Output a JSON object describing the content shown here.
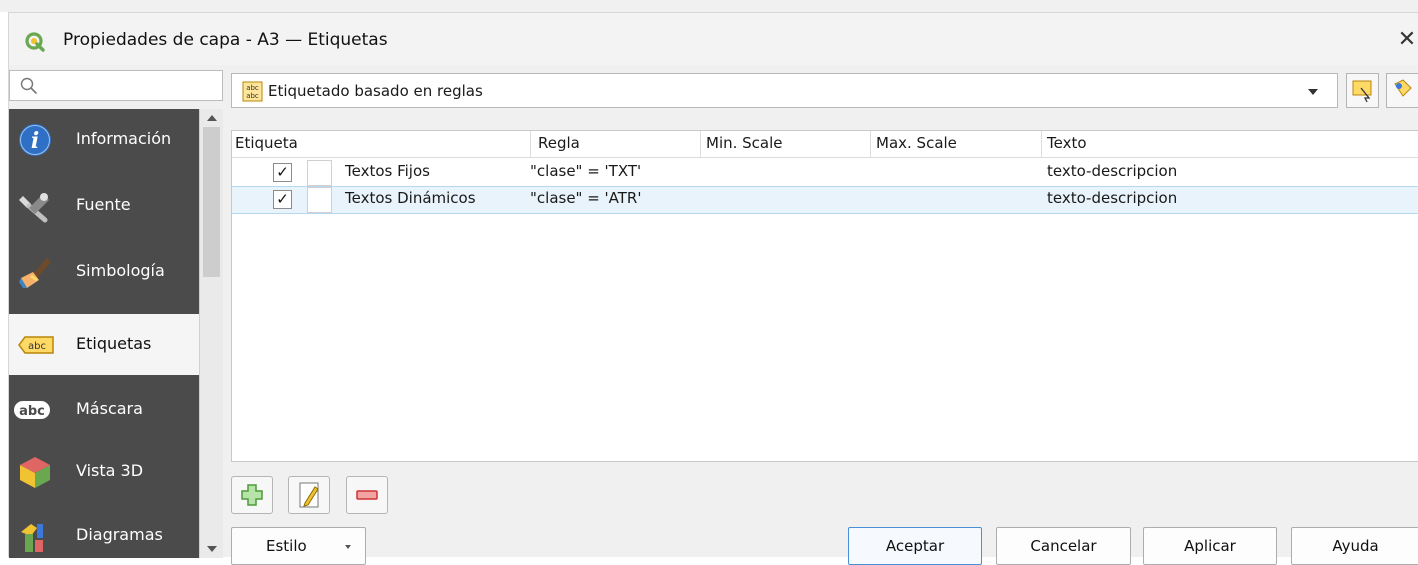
{
  "window": {
    "title": "Propiedades de capa - A3 — Etiquetas",
    "close_glyph": "✕"
  },
  "search": {
    "placeholder": ""
  },
  "sidebar": {
    "items": [
      {
        "label": "Información",
        "icon": "info-icon"
      },
      {
        "label": "Fuente",
        "icon": "source-tools-icon"
      },
      {
        "label": "Simbología",
        "icon": "symbology-brush-icon"
      },
      {
        "label": "Etiquetas",
        "icon": "labels-abc-icon",
        "active": true
      },
      {
        "label": "Máscara",
        "icon": "mask-abc-icon"
      },
      {
        "label": "Vista 3D",
        "icon": "3d-cube-icon"
      },
      {
        "label": "Diagramas",
        "icon": "diagram-icon"
      }
    ]
  },
  "mode": {
    "label": "Etiquetado basado en reglas"
  },
  "tree": {
    "headers": [
      "Etiqueta",
      "Regla",
      "Min. Scale",
      "Max. Scale",
      "Texto"
    ],
    "rows": [
      {
        "checked": "✓",
        "label": "Textos Fijos",
        "rule": "\"clase\"  =  'TXT'",
        "min": "",
        "max": "",
        "text": "texto-descripcion"
      },
      {
        "checked": "✓",
        "label": "Textos Dinámicos",
        "rule": "\"clase\"  =  'ATR'",
        "min": "",
        "max": "",
        "text": "texto-descripcion"
      }
    ]
  },
  "footer": {
    "style_label": "Estilo",
    "accept_label": "Aceptar",
    "cancel_label": "Cancelar",
    "apply_label": "Aplicar",
    "help_label": "Ayuda"
  },
  "colors": {
    "sidebar_bg": "#4b4b4b",
    "selection": "#e8f3fb",
    "accent": "#4a90d9"
  }
}
